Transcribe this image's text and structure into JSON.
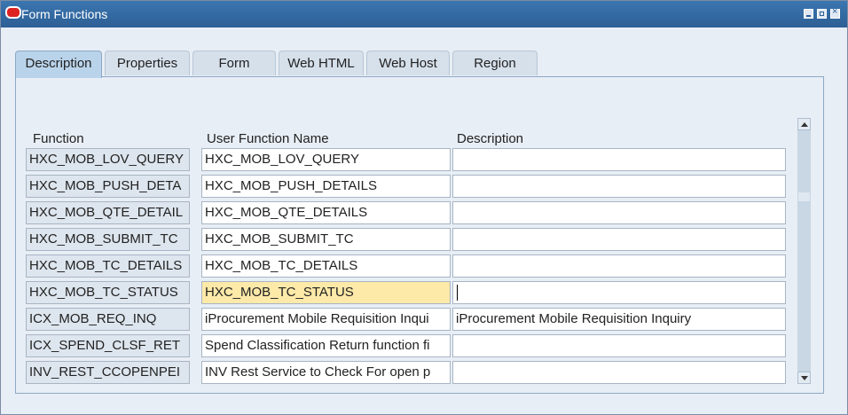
{
  "window": {
    "title": "Form Functions"
  },
  "tabs": [
    {
      "label": "Description",
      "active": true
    },
    {
      "label": "Properties"
    },
    {
      "label": "Form"
    },
    {
      "label": "Web HTML"
    },
    {
      "label": "Web Host"
    },
    {
      "label": "Region"
    }
  ],
  "table": {
    "headers": {
      "function": "Function",
      "user_function_name": "User Function Name",
      "description": "Description"
    },
    "rows": [
      {
        "function": "HXC_MOB_LOV_QUERY",
        "user_function_name": "HXC_MOB_LOV_QUERY",
        "description": ""
      },
      {
        "function": "HXC_MOB_PUSH_DETA",
        "user_function_name": "HXC_MOB_PUSH_DETAILS",
        "description": ""
      },
      {
        "function": "HXC_MOB_QTE_DETAIL",
        "user_function_name": "HXC_MOB_QTE_DETAILS",
        "description": ""
      },
      {
        "function": "HXC_MOB_SUBMIT_TC",
        "user_function_name": "HXC_MOB_SUBMIT_TC",
        "description": ""
      },
      {
        "function": "HXC_MOB_TC_DETAILS",
        "user_function_name": "HXC_MOB_TC_DETAILS",
        "description": ""
      },
      {
        "function": "HXC_MOB_TC_STATUS",
        "user_function_name": "HXC_MOB_TC_STATUS",
        "description": "",
        "current": true
      },
      {
        "function": "ICX_MOB_REQ_INQ",
        "user_function_name": "iProcurement Mobile Requisition Inqui",
        "description": "iProcurement Mobile Requisition Inquiry"
      },
      {
        "function": "ICX_SPEND_CLSF_RET",
        "user_function_name": "Spend Classification Return function fi",
        "description": ""
      },
      {
        "function": "INV_REST_CCOPENPEI",
        "user_function_name": "INV Rest Service to Check For open p",
        "description": ""
      }
    ]
  },
  "colors": {
    "titlebar": "#2c5f95",
    "current_row": "#fde9a8",
    "panel": "#e8eef5"
  }
}
